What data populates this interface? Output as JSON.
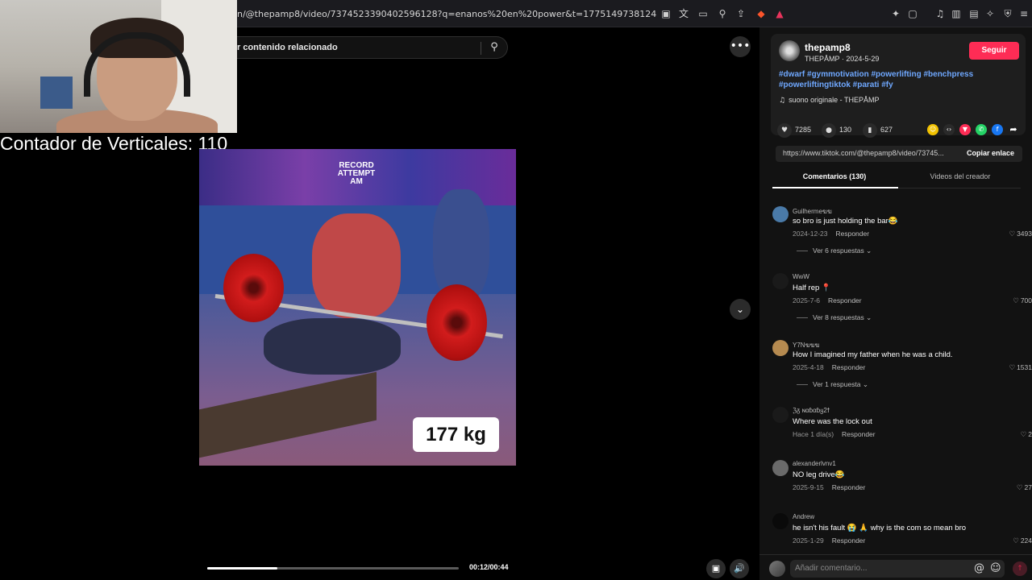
{
  "browser": {
    "url": "n/@thepamp8/video/7374523390402596128?q=enanos%20en%20power&t=1775149738124",
    "toolbar_icons": [
      "reader-mode-icon",
      "translate-icon",
      "cast-icon",
      "zoom-icon",
      "share-icon",
      "brave-shields-icon",
      "rewards-icon",
      "extensions-icon",
      "screenshot-icon",
      "music-icon",
      "sidebar-icon",
      "wallet-icon",
      "leo-icon",
      "vpn-icon",
      "menu-icon"
    ]
  },
  "stream_overlay": {
    "counter_text": "Contador de Verticales: 110"
  },
  "search": {
    "text": "r contenido relacionado"
  },
  "video": {
    "overlay_line1": "RECORD ATTEMPT",
    "overlay_line2": "AM",
    "weight_label": "177 kg",
    "time": "00:12/00:44",
    "progress": 0.28
  },
  "post": {
    "author": "thepamp8",
    "author_sub": "THEPÅMP · 2024-5-29",
    "follow_label": "Seguir",
    "hashtags": "#dwarf #gymmotivation #powerlifting #benchpress #powerliftingtiktok #parati #fy",
    "music": "suono originale - THEPÅMP",
    "likes": "7285",
    "comments": "130",
    "saves": "627",
    "link": "https://www.tiktok.com/@thepamp8/video/73745...",
    "copy_label": "Copiar enlace"
  },
  "tabs": {
    "comments": "Comentarios (130)",
    "creator_videos": "Videos del creador"
  },
  "comments": [
    {
      "user": "Guilhermeฆฆ",
      "text": "so bro is just holding the bar😂",
      "date": "2024-12-23",
      "reply": "Responder",
      "likes": "3493",
      "replies": "Ver 6 respuestas",
      "color": "#4a7aa8"
    },
    {
      "user": "WwW",
      "text": "Half rep 📍",
      "date": "2025-7-6",
      "reply": "Responder",
      "likes": "700",
      "replies": "Ver 8 respuestas",
      "color": "#1a1a1a"
    },
    {
      "user": "Y7Nฆฆฆ",
      "text": "How I imagined my father when he was a child.",
      "date": "2025-4-18",
      "reply": "Responder",
      "likes": "1531",
      "replies": "Ver 1 respuesta",
      "color": "#b58a50"
    },
    {
      "user": "ℨᵹ ɴαɓαɓყ2ϯ",
      "text": "Where was the lock out",
      "date": "Hace 1 día(s)",
      "reply": "Responder",
      "likes": "2",
      "replies": "",
      "color": "#1a1a1a"
    },
    {
      "user": "alexanderlvnv1",
      "text": "NO leg drive😂",
      "date": "2025-9-15",
      "reply": "Responder",
      "likes": "27",
      "replies": "",
      "color": "#6a6a6a"
    },
    {
      "user": "Andrew",
      "text": "he isn't his fault 😭 🙏 why is the com so mean bro",
      "date": "2025-1-29",
      "reply": "Responder",
      "likes": "224",
      "replies": "",
      "color": "#0a0a0a"
    }
  ],
  "compose": {
    "placeholder": "Añadir comentario..."
  },
  "colors": {
    "accent": "#fe2c55",
    "hashtag": "#6fa8ff",
    "panel_bg": "#121212"
  }
}
